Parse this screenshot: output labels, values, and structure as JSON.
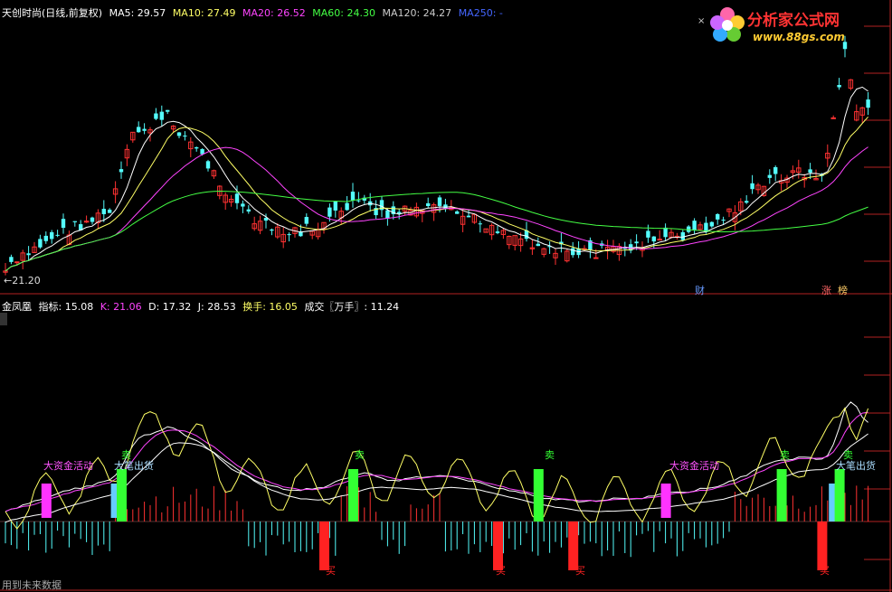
{
  "header_main": {
    "name": "天创时尚(日线,前复权)",
    "items": [
      {
        "label": "MA5: 29.57",
        "color": "#ffffff"
      },
      {
        "label": "MA10: 27.49",
        "color": "#ffff66"
      },
      {
        "label": "MA20: 26.52",
        "color": "#ff44ff"
      },
      {
        "label": "MA60: 24.30",
        "color": "#44ff44"
      },
      {
        "label": "MA120: 24.27",
        "color": "#cccccc"
      },
      {
        "label": "MA250: -",
        "color": "#4444ff"
      }
    ]
  },
  "header_indicator": {
    "items": [
      {
        "label": "金凤凰",
        "color": "#ffffff"
      },
      {
        "label": "指标: 15.08",
        "color": "#ffffff"
      },
      {
        "label": "K: 21.06",
        "color": "#ff44ff"
      },
      {
        "label": "D: 17.32",
        "color": "#ffffff"
      },
      {
        "label": "J: 28.53",
        "color": "#ffffff"
      },
      {
        "label": "换手: 16.05",
        "color": "#ffff66"
      },
      {
        "label": "成交〖万手〗: 11.24",
        "color": "#ffffff"
      }
    ]
  },
  "logo": {
    "title": "分析家公式网",
    "url": "www.88gs.com"
  },
  "low_label": "21.20",
  "event_tags": [
    {
      "text": "财",
      "color": "#6699ff",
      "bg": "#223355"
    },
    {
      "text": "涨",
      "color": "#ff6666",
      "bg": "#331111"
    },
    {
      "text": "榜",
      "color": "#ffcc66",
      "bg": "#332211"
    }
  ],
  "footer": "用到未来数据",
  "chart_data": [
    {
      "type": "candlestick",
      "title": "天创时尚(日线,前复权)",
      "low_marker": 21.2,
      "ma": {
        "MA5": 29.57,
        "MA10": 27.49,
        "MA20": 26.52,
        "MA60": 24.3,
        "MA120": 24.27
      },
      "colors": {
        "up": "#ff3232",
        "down": "#54fcfc",
        "MA5": "#ffffff",
        "MA10": "#ffff66",
        "MA20": "#ff44ff",
        "MA60": "#44ff44"
      }
    },
    {
      "type": "bar",
      "title": "金凤凰",
      "values": {
        "指标": 15.08,
        "K": 21.06,
        "D": 17.32,
        "J": 28.53,
        "换手": 16.05,
        "成交〖万手〗": 11.24
      },
      "signal_labels": [
        "大资金活动",
        "大笔出货",
        "卖",
        "买"
      ],
      "signals": [
        {
          "label": "大资金活动",
          "color": "#ff33ff"
        },
        {
          "label": "大笔出货",
          "color": "#66ccff"
        },
        {
          "label": "卖",
          "color": "#33ff33"
        },
        {
          "label": "买",
          "color": "#ff2222"
        }
      ]
    }
  ]
}
